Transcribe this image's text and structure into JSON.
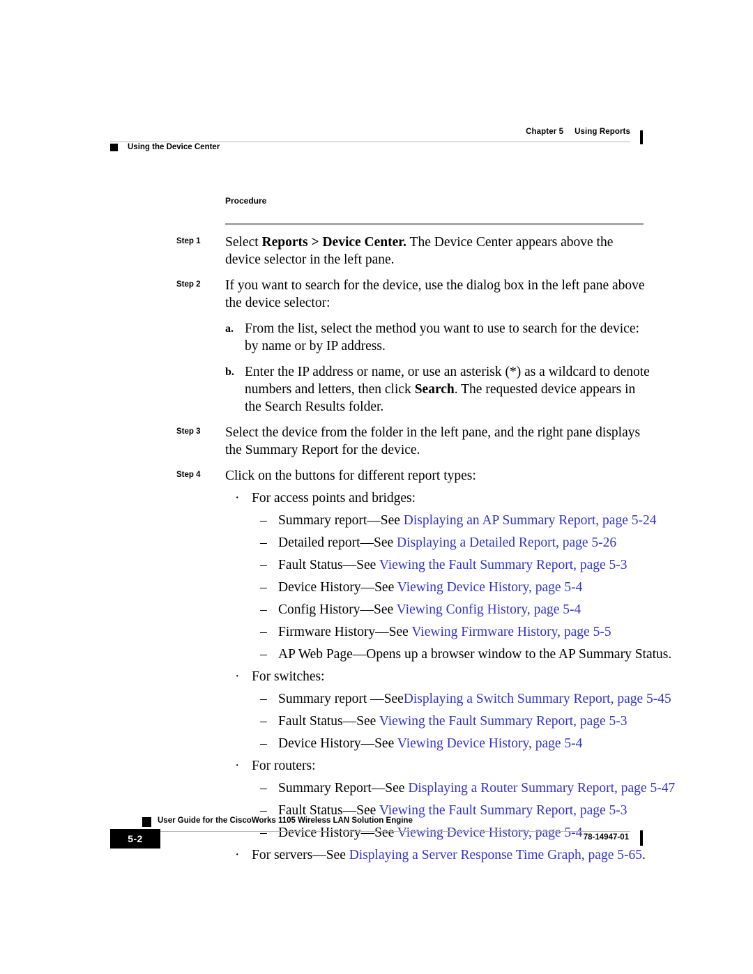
{
  "header": {
    "chapter_number": "Chapter 5",
    "chapter_title": "Using Reports",
    "section_title": "Using the Device Center"
  },
  "body": {
    "procedure_heading": "Procedure",
    "steps": [
      {
        "label": "Step 1",
        "text_parts": [
          {
            "text": "Select ",
            "bold": false
          },
          {
            "text": "Reports > Device Center.",
            "bold": true
          },
          {
            "text": " The Device Center appears above the device selector in the left pane.",
            "bold": false
          }
        ]
      },
      {
        "label": "Step 2",
        "text_parts": [
          {
            "text": "If you want to search for the device, use the dialog box in the left pane above the device selector:",
            "bold": false
          }
        ],
        "substeps": [
          {
            "marker": "a.",
            "text_parts": [
              {
                "text": "From the list, select the method you want to use to search for the device: by name or by IP address.",
                "bold": false
              }
            ]
          },
          {
            "marker": "b.",
            "text_parts": [
              {
                "text": "Enter the IP address or name, or use an asterisk (*) as a wildcard to denote numbers and letters, then click ",
                "bold": false
              },
              {
                "text": "Search",
                "bold": true
              },
              {
                "text": ". The requested device appears in the Search Results folder.",
                "bold": false
              }
            ]
          }
        ]
      },
      {
        "label": "Step 3",
        "text_parts": [
          {
            "text": "Select the device from the folder in the left pane, and the right pane displays the Summary Report for the device.",
            "bold": false
          }
        ]
      },
      {
        "label": "Step 4",
        "text_parts": [
          {
            "text": "Click on the buttons for different report types:",
            "bold": false
          }
        ]
      }
    ],
    "bullets": [
      {
        "bullet_char": "·",
        "text": "For access points and bridges:",
        "dashes": [
          {
            "mark": "–",
            "plain": "Summary report—See ",
            "link": "Displaying an AP Summary Report, page 5-24",
            "tail": ""
          },
          {
            "mark": "–",
            "plain": "Detailed report—See ",
            "link": "Displaying a Detailed Report, page 5-26",
            "tail": ""
          },
          {
            "mark": "–",
            "plain": "Fault Status—See ",
            "link": "Viewing the Fault Summary Report, page 5-3",
            "tail": ""
          },
          {
            "mark": "–",
            "plain": "Device History—See ",
            "link": "Viewing Device History, page 5-4",
            "tail": ""
          },
          {
            "mark": "–",
            "plain": "Config History—See ",
            "link": "Viewing Config History, page 5-4",
            "tail": ""
          },
          {
            "mark": "–",
            "plain": "Firmware History—See ",
            "link": "Viewing Firmware History, page 5-5",
            "tail": ""
          },
          {
            "mark": "–",
            "plain": "AP Web Page—Opens up a browser window to the AP Summary Status.",
            "link": "",
            "tail": ""
          }
        ]
      },
      {
        "bullet_char": "·",
        "text": "For switches:",
        "dashes": [
          {
            "mark": "–",
            "plain": "Summary report —See",
            "link": "Displaying a Switch Summary Report, page 5-45",
            "tail": ""
          },
          {
            "mark": "–",
            "plain": "Fault Status—See ",
            "link": "Viewing the Fault Summary Report, page 5-3",
            "tail": ""
          },
          {
            "mark": "–",
            "plain": "Device History—See ",
            "link": "Viewing Device History, page 5-4",
            "tail": ""
          }
        ]
      },
      {
        "bullet_char": "·",
        "text": "For routers:",
        "dashes": [
          {
            "mark": "–",
            "plain": "Summary Report—See ",
            "link": "Displaying a Router Summary Report, page 5-47",
            "tail": ""
          },
          {
            "mark": "–",
            "plain": "Fault Status—See ",
            "link": "Viewing the Fault Summary Report, page 5-3",
            "tail": ""
          },
          {
            "mark": "–",
            "plain": "Device History—See ",
            "link": "Viewing Device History, page 5-4",
            "tail": ""
          }
        ]
      }
    ],
    "final_bullet": {
      "bullet_char": "·",
      "plain": "For servers—See ",
      "link": "Displaying a Server Response Time Graph, page 5-65",
      "tail": "."
    }
  },
  "footer": {
    "guide_title": "User Guide for the CiscoWorks 1105 Wireless LAN Solution Engine",
    "page_number": "5-2",
    "document_number": "78-14947-01"
  },
  "colors": {
    "cross_reference_link": "#3333cc",
    "rule_gray": "#b4b4b4",
    "procedure_rule_gray": "#a8a8a8",
    "marker_black": "#000000"
  }
}
